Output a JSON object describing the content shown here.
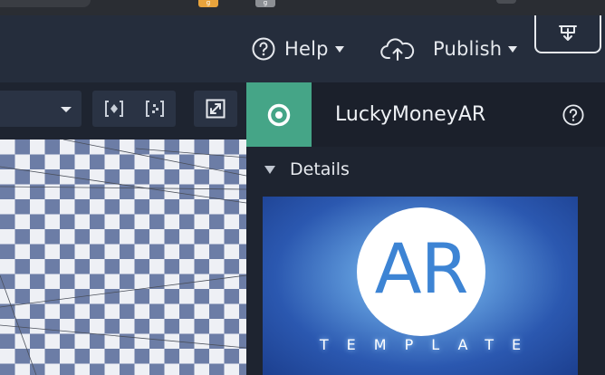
{
  "browser": {
    "tab1_favicon": "g",
    "tab2_favicon": "g"
  },
  "toolbar": {
    "help_label": "Help",
    "publish_label": "Publish",
    "help_icon": "question-circle-icon",
    "publish_icon": "cloud-upload-icon",
    "download_icon": "download-tray-icon"
  },
  "viewport": {
    "buttons": [
      "select-dropdown",
      "frame-selection",
      "frame-all",
      "fullscreen"
    ]
  },
  "panel": {
    "project_name": "LuckyMoneyAR",
    "section_title": "Details",
    "thumbnail": {
      "logo_text": "AR",
      "subtitle": "TEMPLATE"
    }
  },
  "colors": {
    "accent_green": "#45a587",
    "toolbar_bg": "#252d3c",
    "panel_bg": "#1e2430"
  }
}
